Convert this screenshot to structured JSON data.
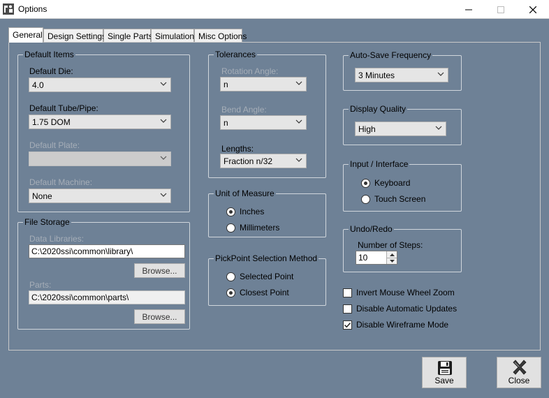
{
  "window": {
    "title": "Options"
  },
  "tabs": [
    "General",
    "Design Settings",
    "Single Parts",
    "Simulation",
    "Misc Options"
  ],
  "default_items": {
    "title": "Default Items",
    "die_label": "Default Die:",
    "die_value": "4.0",
    "tube_label": "Default Tube/Pipe:",
    "tube_value": "1.75 DOM",
    "plate_label": "Default Plate:",
    "plate_value": "",
    "machine_label": "Default Machine:",
    "machine_value": "None"
  },
  "file_storage": {
    "title": "File Storage",
    "data_label": "Data Libraries:",
    "data_value": "C:\\2020ssi\\common\\library\\",
    "browse1": "Browse...",
    "parts_label": "Parts:",
    "parts_value": "C:\\2020ssi\\common\\parts\\",
    "browse2": "Browse..."
  },
  "tolerances": {
    "title": "Tolerances",
    "rotation_label": "Rotation Angle:",
    "rotation_value": "n",
    "bend_label": "Bend Angle:",
    "bend_value": "n",
    "lengths_label": "Lengths:",
    "lengths_value": "Fraction n/32"
  },
  "unit": {
    "title": "Unit of Measure",
    "inches": "Inches",
    "mm": "Millimeters"
  },
  "pickpoint": {
    "title": "PickPoint Selection Method",
    "selected": "Selected Point",
    "closest": "Closest Point"
  },
  "autosave": {
    "title": "Auto-Save Frequency",
    "value": "3 Minutes"
  },
  "display": {
    "title": "Display Quality",
    "value": "High"
  },
  "input": {
    "title": "Input / Interface",
    "keyboard": "Keyboard",
    "touch": "Touch Screen"
  },
  "undo": {
    "title": "Undo/Redo",
    "steps_label": "Number of Steps:",
    "steps_value": "10"
  },
  "checks": {
    "invert": "Invert Mouse Wheel Zoom",
    "updates": "Disable Automatic Updates",
    "wireframe": "Disable Wireframe Mode"
  },
  "buttons": {
    "save": "Save",
    "close": "Close"
  }
}
